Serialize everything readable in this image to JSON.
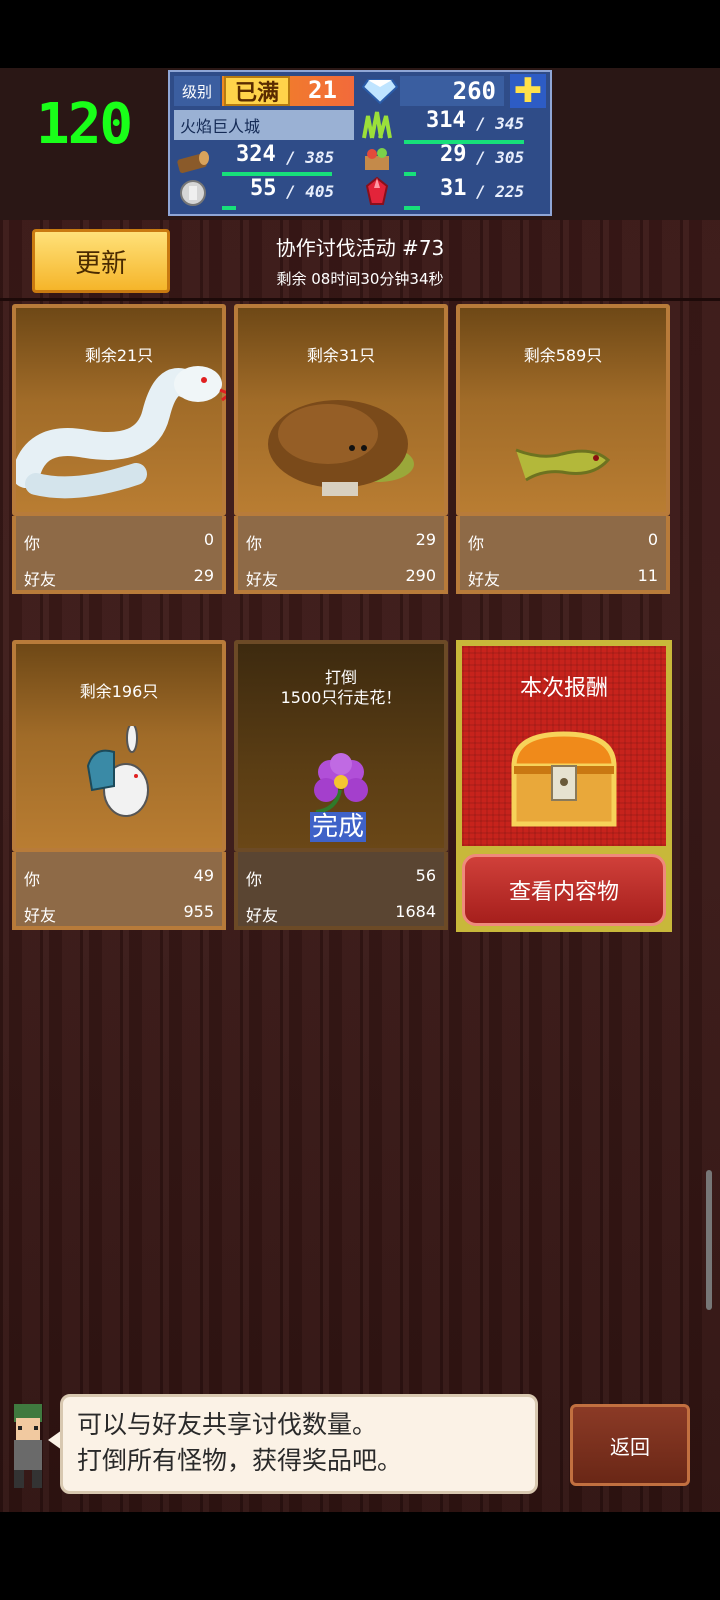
{
  "fps": "120",
  "hud": {
    "level_label": "级别",
    "level_max_badge": "已满",
    "level_value": "21",
    "gems": "260",
    "town_name": "火焰巨人城",
    "resources": [
      {
        "icon": "grass-icon",
        "value": "314",
        "max": "345",
        "fill": 0.91
      },
      {
        "icon": "wood-log-icon",
        "value": "324",
        "max": "385",
        "fill": 0.84
      },
      {
        "icon": "food-basket-icon",
        "value": "29",
        "max": "305",
        "fill": 0.1
      },
      {
        "icon": "ore-icon",
        "value": "55",
        "max": "405",
        "fill": 0.14
      },
      {
        "icon": "red-crystal-icon",
        "value": "31",
        "max": "225",
        "fill": 0.14
      }
    ]
  },
  "header": {
    "refresh_label": "更新",
    "event_title": "协作讨伐活动 #73",
    "time_remaining": "剩余 08时间30分钟34秒"
  },
  "cards": [
    {
      "remaining": "剩余21只",
      "you_label": "你",
      "you": "0",
      "friend_label": "好友",
      "friends": "29",
      "monster": "white-snake"
    },
    {
      "remaining": "剩余31只",
      "you_label": "你",
      "you": "29",
      "friend_label": "好友",
      "friends": "290",
      "monster": "mushroom"
    },
    {
      "remaining": "剩余589只",
      "you_label": "你",
      "you": "0",
      "friend_label": "好友",
      "friends": "11",
      "monster": "green-lizard"
    },
    {
      "remaining": "剩余196只",
      "you_label": "你",
      "you": "49",
      "friend_label": "好友",
      "friends": "955",
      "monster": "rabbit-knight"
    },
    {
      "defeat_line1": "打倒",
      "defeat_line2": "1500只行走花！",
      "done": "完成",
      "you_label": "你",
      "you": "56",
      "friend_label": "好友",
      "friends": "1684",
      "monster": "walking-flower"
    }
  ],
  "reward": {
    "title": "本次报酬",
    "button": "查看内容物"
  },
  "dialog": {
    "line1": "可以与好友共享讨伐数量。",
    "line2": "打倒所有怪物，获得奖品吧。"
  },
  "back_label": "返回"
}
